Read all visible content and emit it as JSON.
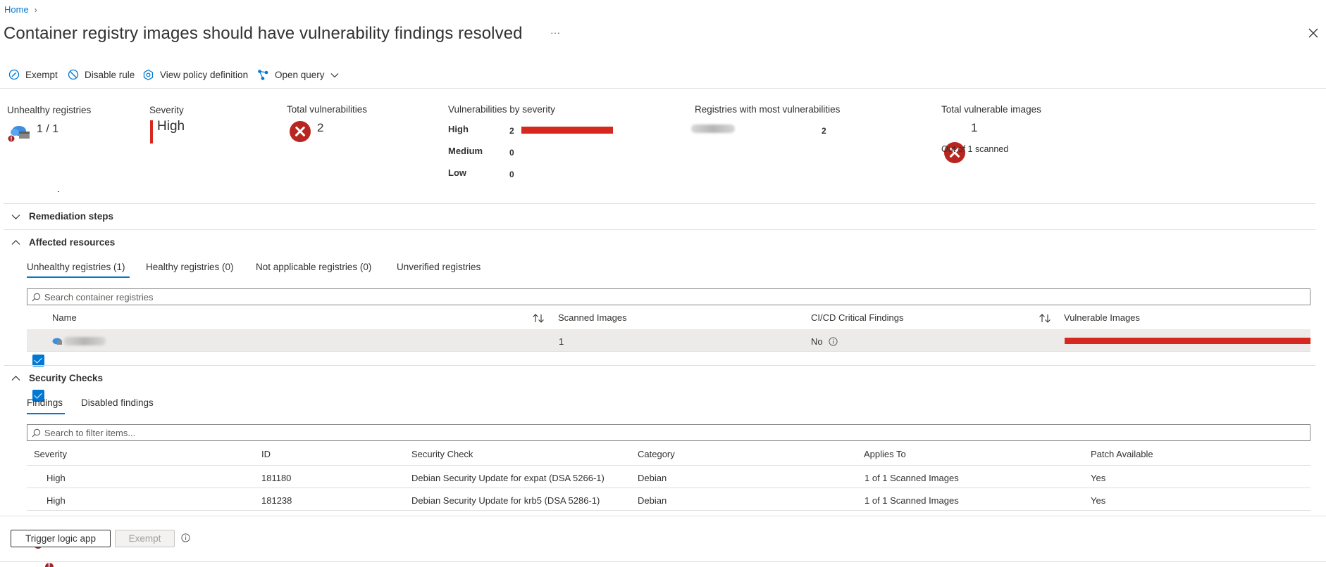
{
  "breadcrumb": {
    "home": "Home",
    "separator": "›"
  },
  "page": {
    "title": "Container registry images should have vulnerability findings resolved",
    "more": "···"
  },
  "toolbar": {
    "exempt": "Exempt",
    "disable_rule": "Disable rule",
    "view_policy": "View policy definition",
    "open_query": "Open query"
  },
  "summary": {
    "unhealthy_registries": {
      "label": "Unhealthy registries",
      "value": "1 / 1"
    },
    "severity": {
      "label": "Severity",
      "value": "High"
    },
    "total_vulnerabilities": {
      "label": "Total vulnerabilities",
      "value": "2"
    },
    "by_severity": {
      "label": "Vulnerabilities by severity",
      "rows": [
        {
          "name": "High",
          "count": "2",
          "fraction": 1.0
        },
        {
          "name": "Medium",
          "count": "0",
          "fraction": 0
        },
        {
          "name": "Low",
          "count": "0",
          "fraction": 0
        }
      ]
    },
    "most_vulnerable": {
      "label": "Registries with most vulnerabilities",
      "count": "2"
    },
    "vulnerable_images": {
      "label": "Total vulnerable images",
      "value": "1",
      "sub": "Out of 1 scanned"
    }
  },
  "sections": {
    "remediation": "Remediation steps",
    "affected": "Affected resources",
    "security_checks": "Security Checks"
  },
  "affected": {
    "tabs": [
      "Unhealthy registries (1)",
      "Healthy registries (0)",
      "Not applicable registries (0)",
      "Unverified registries"
    ],
    "search_placeholder": "Search container registries",
    "columns": {
      "name": "Name",
      "scanned": "Scanned Images",
      "cicd": "CI/CD Critical Findings",
      "vulnerable": "Vulnerable Images"
    },
    "rows": [
      {
        "scanned": "1",
        "cicd": "No",
        "vulnerable_fraction": 1.0
      }
    ]
  },
  "findings": {
    "tabs": [
      "Findings",
      "Disabled findings"
    ],
    "search_placeholder": "Search to filter items...",
    "columns": [
      "Severity",
      "ID",
      "Security Check",
      "Category",
      "Applies To",
      "Patch Available"
    ],
    "rows": [
      {
        "severity": "High",
        "id": "181180",
        "check": "Debian Security Update for expat (DSA 5266-1)",
        "category": "Debian",
        "applies": "1 of 1 Scanned Images",
        "patch": "Yes"
      },
      {
        "severity": "High",
        "id": "181238",
        "check": "Debian Security Update for krb5 (DSA 5286-1)",
        "category": "Debian",
        "applies": "1 of 1 Scanned Images",
        "patch": "Yes"
      }
    ]
  },
  "footer": {
    "trigger": "Trigger logic app",
    "exempt": "Exempt"
  },
  "colors": {
    "accent": "#0078d4",
    "danger": "#d6281f",
    "error_icon": "#b8261f"
  }
}
